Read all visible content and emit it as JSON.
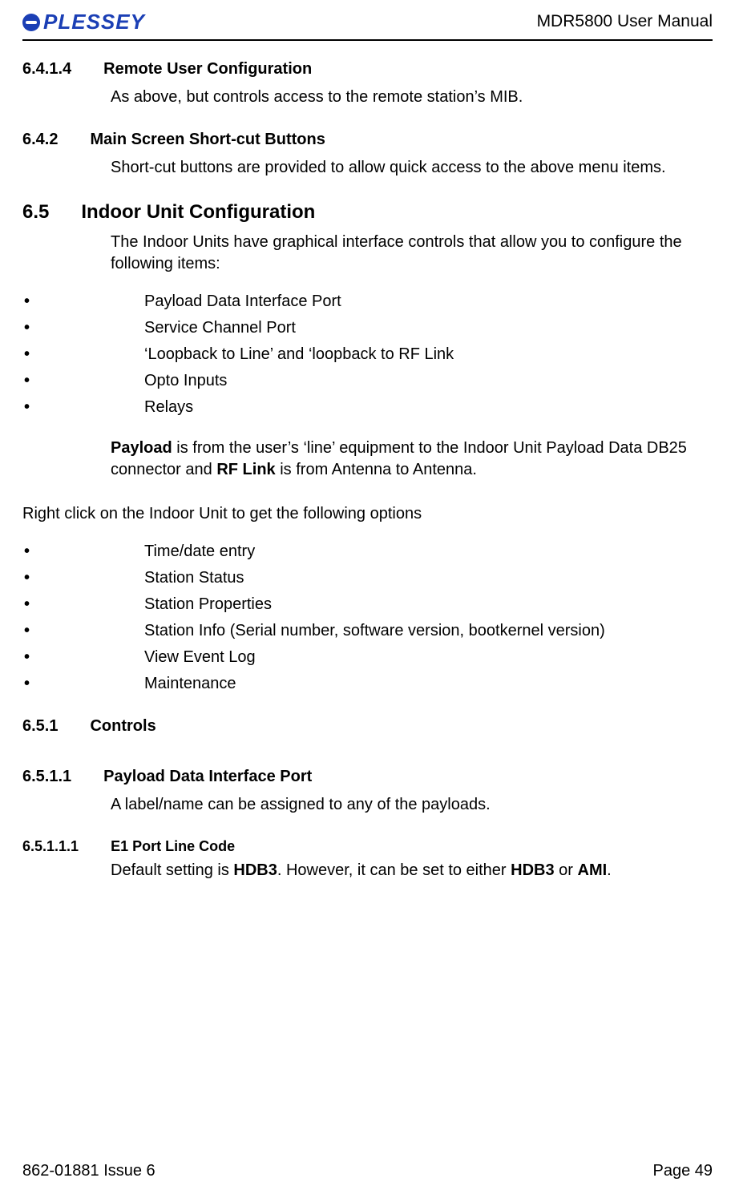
{
  "header": {
    "logo_text": "PLESSEY",
    "doc_title": "MDR5800 User Manual"
  },
  "sections": {
    "s_6_4_1_4": {
      "num": "6.4.1.4",
      "title": "Remote User Configuration",
      "body": "As above, but controls access to the remote station’s MIB."
    },
    "s_6_4_2": {
      "num": "6.4.2",
      "title": "Main Screen Short-cut Buttons",
      "body": "Short-cut buttons are provided to allow quick access to the above menu items."
    },
    "s_6_5": {
      "num": "6.5",
      "title": "Indoor Unit Configuration",
      "body": "The Indoor Units have graphical interface controls that allow you to configure the following items:",
      "list1": [
        "Payload Data Interface Port",
        "Service Channel Port",
        "‘Loopback to Line’ and ‘loopback to RF Link",
        "Opto Inputs",
        "Relays"
      ],
      "para1_prefix": "Payload",
      "para1_mid": " is from the user’s ‘line’ equipment to the Indoor Unit Payload Data DB25 connector and ",
      "para1_bold2": "RF Link",
      "para1_suffix": " is from Antenna to Antenna.",
      "para2": "Right click on the Indoor Unit to get the following options",
      "list2": [
        "Time/date entry",
        "Station Status",
        "Station Properties",
        "Station Info (Serial number, software version, bootkernel version)",
        "View Event Log",
        "Maintenance"
      ]
    },
    "s_6_5_1": {
      "num": "6.5.1",
      "title": "Controls"
    },
    "s_6_5_1_1": {
      "num": "6.5.1.1",
      "title": "Payload Data Interface Port",
      "body": "A label/name can be assigned to any of the payloads."
    },
    "s_6_5_1_1_1": {
      "num": "6.5.1.1.1",
      "title": "E1 Port Line Code",
      "body_prefix": "Default setting is ",
      "body_b1": "HDB3",
      "body_mid": ".  However, it can be set to either ",
      "body_b2": "HDB3",
      "body_mid2": " or ",
      "body_b3": "AMI",
      "body_suffix": "."
    }
  },
  "footer": {
    "left": "862-01881 Issue 6",
    "right": "Page 49"
  }
}
